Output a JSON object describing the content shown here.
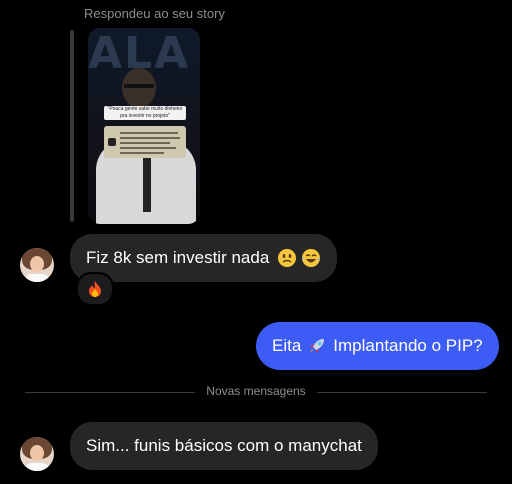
{
  "story_reply": {
    "caption": "Respondeu ao seu story",
    "thumbnail_letters": "ALA",
    "thumbnail_quote": "\"Pouca gente sabe muito dinheiro pra investir no projeto\""
  },
  "messages": [
    {
      "direction": "incoming",
      "text": "Fiz 8k sem investir nada",
      "emojis": [
        "face-holding-back-tears",
        "joy"
      ],
      "reaction": "fire"
    },
    {
      "direction": "outgoing",
      "text_before": "Eita",
      "emoji": "rocket",
      "text_after": "Implantando o PIP?"
    },
    {
      "direction": "incoming",
      "text": "Sim... funis básicos com o manychat"
    }
  ],
  "divider": {
    "label": "Novas mensagens"
  },
  "colors": {
    "background": "#000000",
    "incoming_bubble": "#262626",
    "outgoing_bubble": "#3d5bf5",
    "muted_text": "#8e8e93"
  }
}
